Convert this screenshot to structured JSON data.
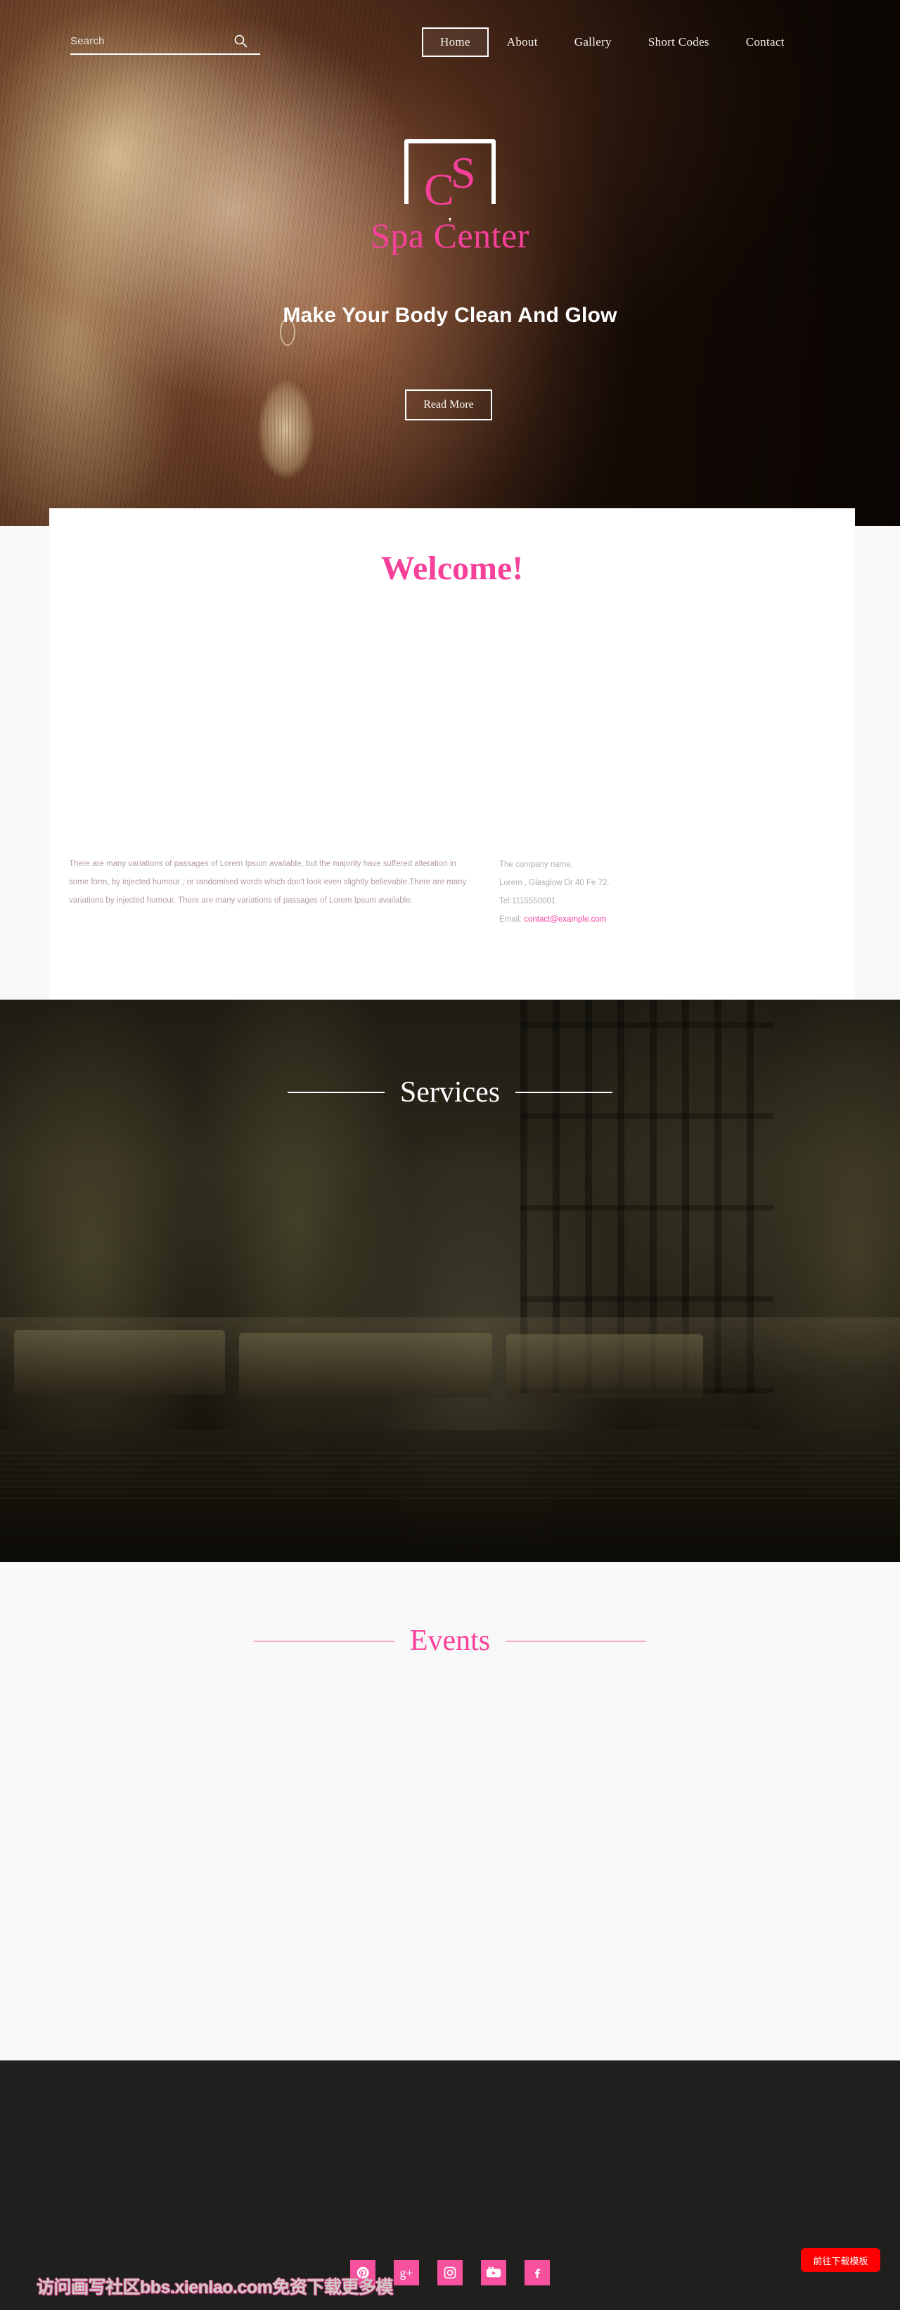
{
  "header": {
    "search": {
      "placeholder": "Search",
      "value": "",
      "icon": "search-icon"
    },
    "nav": [
      {
        "label": "Home",
        "active": true
      },
      {
        "label": "About",
        "active": false
      },
      {
        "label": "Gallery",
        "active": false
      },
      {
        "label": "Short Codes",
        "active": false
      },
      {
        "label": "Contact",
        "active": false
      }
    ]
  },
  "hero": {
    "logo": {
      "letter_top": "S",
      "letter_bottom": "C",
      "icon": "shield-badge-icon"
    },
    "brand": "Spa Center",
    "tagline": "Make Your Body Clean And Glow",
    "cta": "Read More"
  },
  "welcome": {
    "title": "Welcome!",
    "paragraph": "There are many variations of passages of Lorem Ipsum available, but the majority have suffered alteration in some form, by injected humour , or randomised words which don't look even slightly believable.There are many variations by injected humour. There are many variations of passages of Lorem Ipsum available.",
    "contact": {
      "company": "The company name,",
      "address": "Lorem , Glasglow Dr 40 Fe 72.",
      "phone": "Tel:1115550001",
      "email_label": "Email:",
      "email": "contact@example.com"
    }
  },
  "services": {
    "title": "Services"
  },
  "events": {
    "title": "Events"
  },
  "footer": {
    "socials": [
      {
        "name": "pinterest",
        "glyph": "P"
      },
      {
        "name": "google-plus",
        "glyph": "g+"
      },
      {
        "name": "instagram",
        "glyph": "▣"
      },
      {
        "name": "youtube",
        "glyph": "▶"
      },
      {
        "name": "facebook",
        "glyph": "f"
      }
    ],
    "watermark": "访问画写社区bbs.xienlao.com免资下载更多模",
    "download_button": "前往下载模板"
  },
  "colors": {
    "accent_pink": "#f7409a",
    "social_pink": "#f7509d",
    "download_red": "#ff0000",
    "footer_dark": "#1f1f1e",
    "page_bg": "#f8f8f8"
  }
}
